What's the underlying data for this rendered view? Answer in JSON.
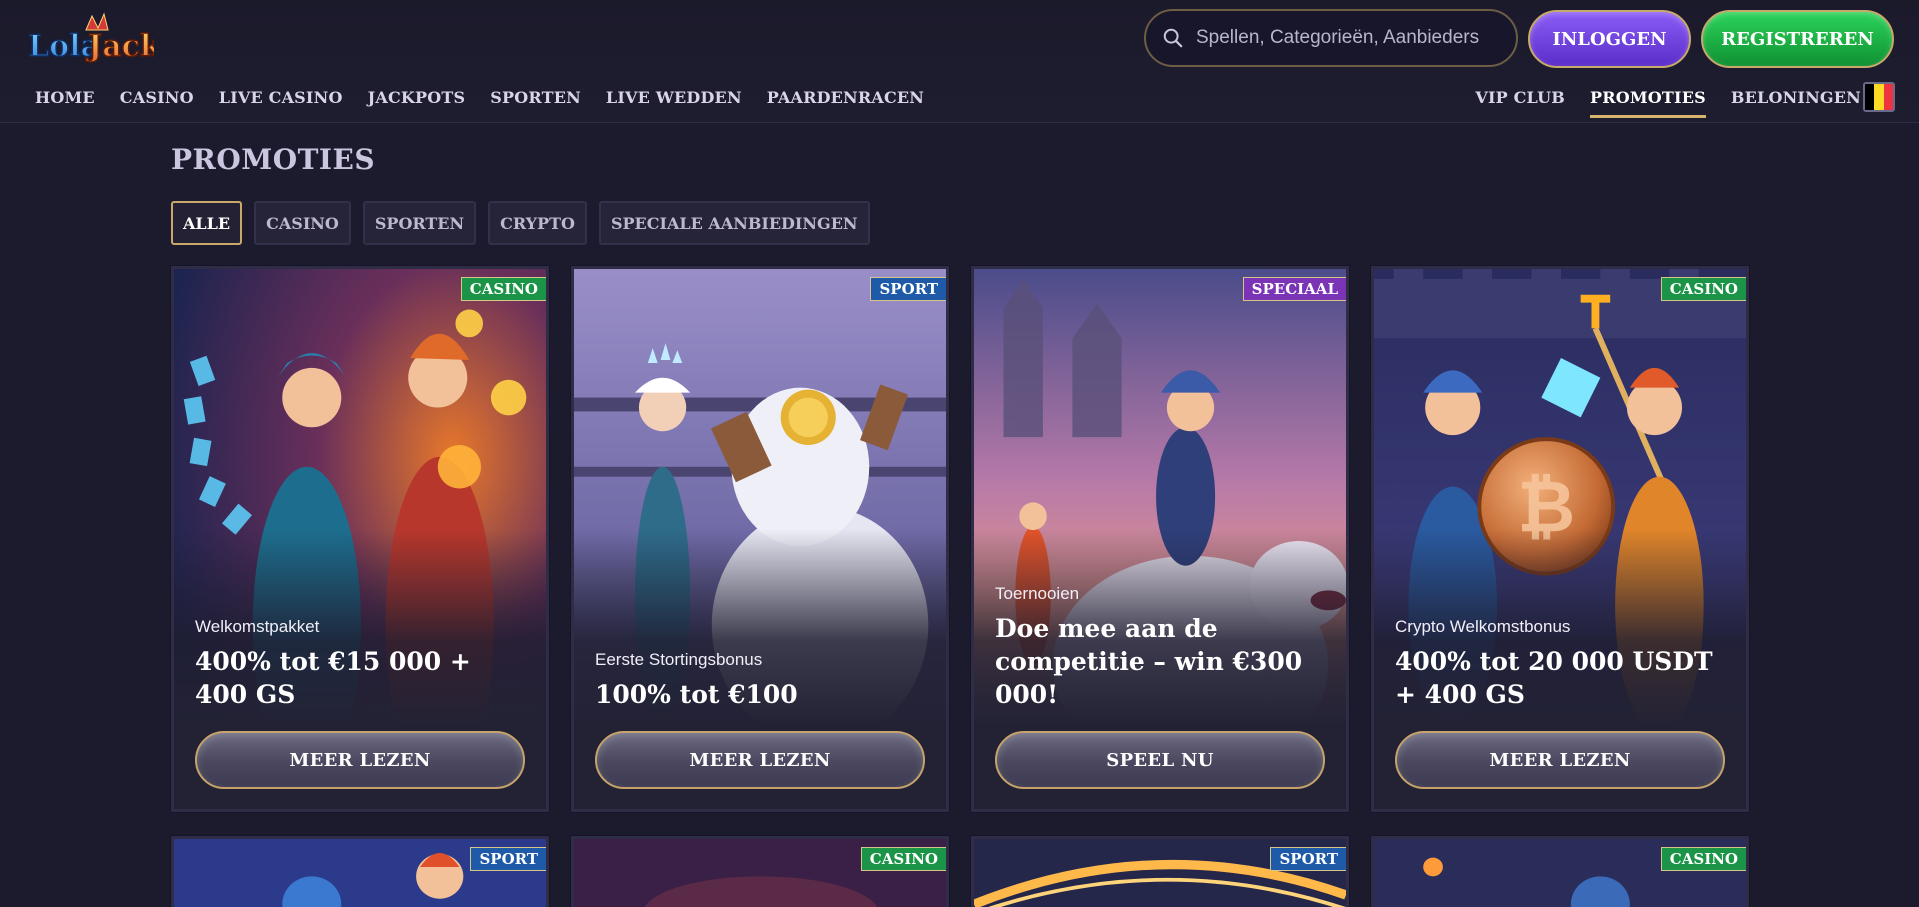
{
  "brand": {
    "logo_text": "LolaJack"
  },
  "header": {
    "search_placeholder": "Spellen, Categorieën, Aanbieders",
    "login_label": "INLOGGEN",
    "register_label": "REGISTREREN"
  },
  "nav": {
    "left": [
      "HOME",
      "CASINO",
      "LIVE CASINO",
      "JACKPOTS",
      "SPORTEN",
      "LIVE WEDDEN",
      "PAARDENRACEN"
    ],
    "right": [
      "VIP CLUB",
      "PROMOTIES",
      "BELONINGEN"
    ],
    "active": "PROMOTIES",
    "language_flag": "belgium-flag",
    "flag_colors": [
      "#000000",
      "#fdda24",
      "#ef3340"
    ]
  },
  "page": {
    "title": "PROMOTIES",
    "filters": [
      "ALLE",
      "CASINO",
      "SPORTEN",
      "CRYPTO",
      "SPECIALE AANBIEDINGEN"
    ],
    "active_filter": "ALLE"
  },
  "colors": {
    "background": "#1c1b2e",
    "accent_gold": "#c9a96a",
    "login_purple": "#6d3fe0",
    "register_green": "#1cb446",
    "badge_casino": "#1b9448",
    "badge_sport": "#1f5aa8",
    "badge_speciaal": "#7a34b5"
  },
  "promotions": [
    {
      "badge": "CASINO",
      "subtitle": "Welkomstpakket",
      "headline": "400% tot €15 000 + 400 GS",
      "button": "MEER LEZEN"
    },
    {
      "badge": "SPORT",
      "subtitle": "Eerste Stortingsbonus",
      "headline": "100% tot €100",
      "button": "MEER LEZEN"
    },
    {
      "badge": "SPECIAAL",
      "subtitle": "Toernooien",
      "headline": "Doe mee aan de competitie – win €300 000!",
      "button": "SPEEL NU"
    },
    {
      "badge": "CASINO",
      "subtitle": "Crypto Welkomstbonus",
      "headline": "400% tot 20 000 USDT + 400 GS",
      "button": "MEER LEZEN"
    },
    {
      "badge": "SPORT"
    },
    {
      "badge": "CASINO"
    },
    {
      "badge": "SPORT"
    },
    {
      "badge": "CASINO"
    }
  ]
}
